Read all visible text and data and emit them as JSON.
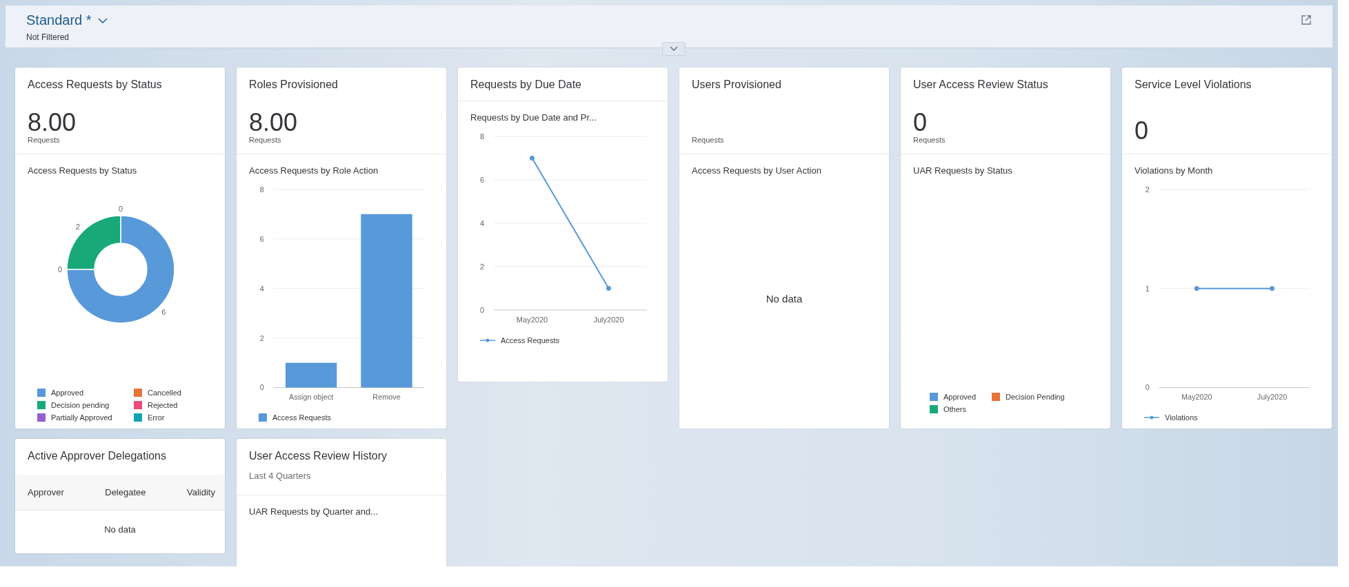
{
  "header": {
    "title": "Standard *",
    "filter_status": "Not Filtered"
  },
  "top_cards": [
    {
      "title": "Access Requests by Status",
      "value": "8.00",
      "unit": "Requests",
      "body": {
        "kind": "donut",
        "subtitle": "Access Requests by Status",
        "chart_data": {
          "type": "donut",
          "categories": [
            "Approved",
            "Cancelled",
            "Decision pending",
            "Rejected",
            "Partially Approved",
            "Error"
          ],
          "colors": [
            "#5899da",
            "#e8743b",
            "#19a979",
            "#ed4a7b",
            "#945ecf",
            "#13a4b4"
          ],
          "values": [
            6,
            0,
            2,
            0,
            0,
            0
          ],
          "value_labels": [
            "6",
            "0",
            "2",
            "0",
            null,
            null
          ]
        }
      }
    },
    {
      "title": "Roles Provisioned",
      "value": "8.00",
      "unit": "Requests",
      "body": {
        "kind": "bar",
        "subtitle": "Access Requests by Role Action",
        "chart_data": {
          "type": "bar",
          "categories": [
            "Assign object",
            "Remove"
          ],
          "series": [
            {
              "name": "Access Requests",
              "color": "#5899da",
              "values": [
                1,
                7
              ]
            }
          ],
          "ylim": [
            0,
            8
          ],
          "yticks": [
            0,
            2,
            4,
            6,
            8
          ],
          "grid": true
        }
      }
    },
    {
      "title": "Requests by Due Date",
      "body": {
        "kind": "line",
        "subtitle": "Requests by Due Date and Pr...",
        "chart_data": {
          "type": "line",
          "categories": [
            "May2020",
            "July2020"
          ],
          "series": [
            {
              "name": "Access Requests",
              "color": "#5899da",
              "values": [
                7,
                1
              ],
              "marker": "circle"
            }
          ],
          "ylim": [
            0,
            8
          ],
          "yticks": [
            0,
            2,
            4,
            6,
            8
          ],
          "grid": true
        }
      }
    },
    {
      "title": "Users Provisioned",
      "unit": "Requests",
      "body": {
        "kind": "nodata",
        "subtitle": "Access Requests by User Action",
        "message": "No data"
      }
    },
    {
      "title": "User Access Review Status",
      "value": "0",
      "unit": "Requests",
      "body": {
        "kind": "legend",
        "subtitle": "UAR Requests by Status",
        "legend": [
          {
            "label": "Approved",
            "color": "#5899da"
          },
          {
            "label": "Decision Pending",
            "color": "#e8743b"
          },
          {
            "label": "Others",
            "color": "#19a979"
          }
        ]
      }
    },
    {
      "title": "Service Level Violations",
      "value": "0",
      "body": {
        "kind": "line",
        "subtitle": "Violations by Month",
        "chart_data": {
          "type": "line",
          "categories": [
            "May2020",
            "July2020"
          ],
          "series": [
            {
              "name": "Violations",
              "color": "#5899da",
              "values": [
                1,
                1
              ],
              "marker": "circle"
            }
          ],
          "ylim": [
            0,
            2
          ],
          "yticks": [
            0,
            1,
            2
          ],
          "grid": true
        }
      }
    }
  ],
  "bottom_cards": [
    {
      "title": "Active Approver Delegations",
      "body": {
        "kind": "table",
        "columns": [
          "Approver",
          "Delegatee",
          "Validity"
        ],
        "message": "No data"
      }
    },
    {
      "title": "User Access Review History",
      "note": "Last 4 Quarters",
      "body": {
        "kind": "text",
        "subtitle": "UAR Requests by Quarter and..."
      }
    }
  ]
}
